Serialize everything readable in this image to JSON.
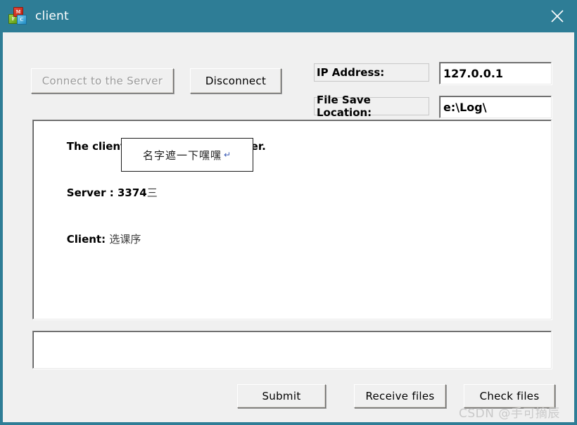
{
  "window": {
    "title": "client",
    "icon": "app-cubes-icon",
    "titlebar_color": "#2e7d96",
    "client_bg": "#f0f0f0",
    "close_label": "×"
  },
  "toolbar": {
    "connect_label": "Connect to the Server",
    "connect_enabled": false,
    "disconnect_label": "Disconnect",
    "disconnect_enabled": true
  },
  "fields": {
    "ip_label": "IP Address:",
    "ip_value": "127.0.0.1",
    "ip_placeholder": "",
    "save_label": "File Save Location:",
    "save_value": "e:\\Log\\",
    "save_placeholder": ""
  },
  "log": {
    "line1": "The client connects to the server.",
    "line2_prefix": "Server : 3374",
    "line2_cn": "三",
    "line3_prefix": "Client: ",
    "line3_cn": "选课序"
  },
  "annotation": {
    "text": "名字遮一下嘿嘿",
    "mark": "↵"
  },
  "message": {
    "value": "",
    "placeholder": ""
  },
  "actions": {
    "submit_label": "Submit",
    "receive_label": "Receive files",
    "check_label": "Check files"
  },
  "watermark": {
    "text": "CSDN @手可摘辰"
  }
}
